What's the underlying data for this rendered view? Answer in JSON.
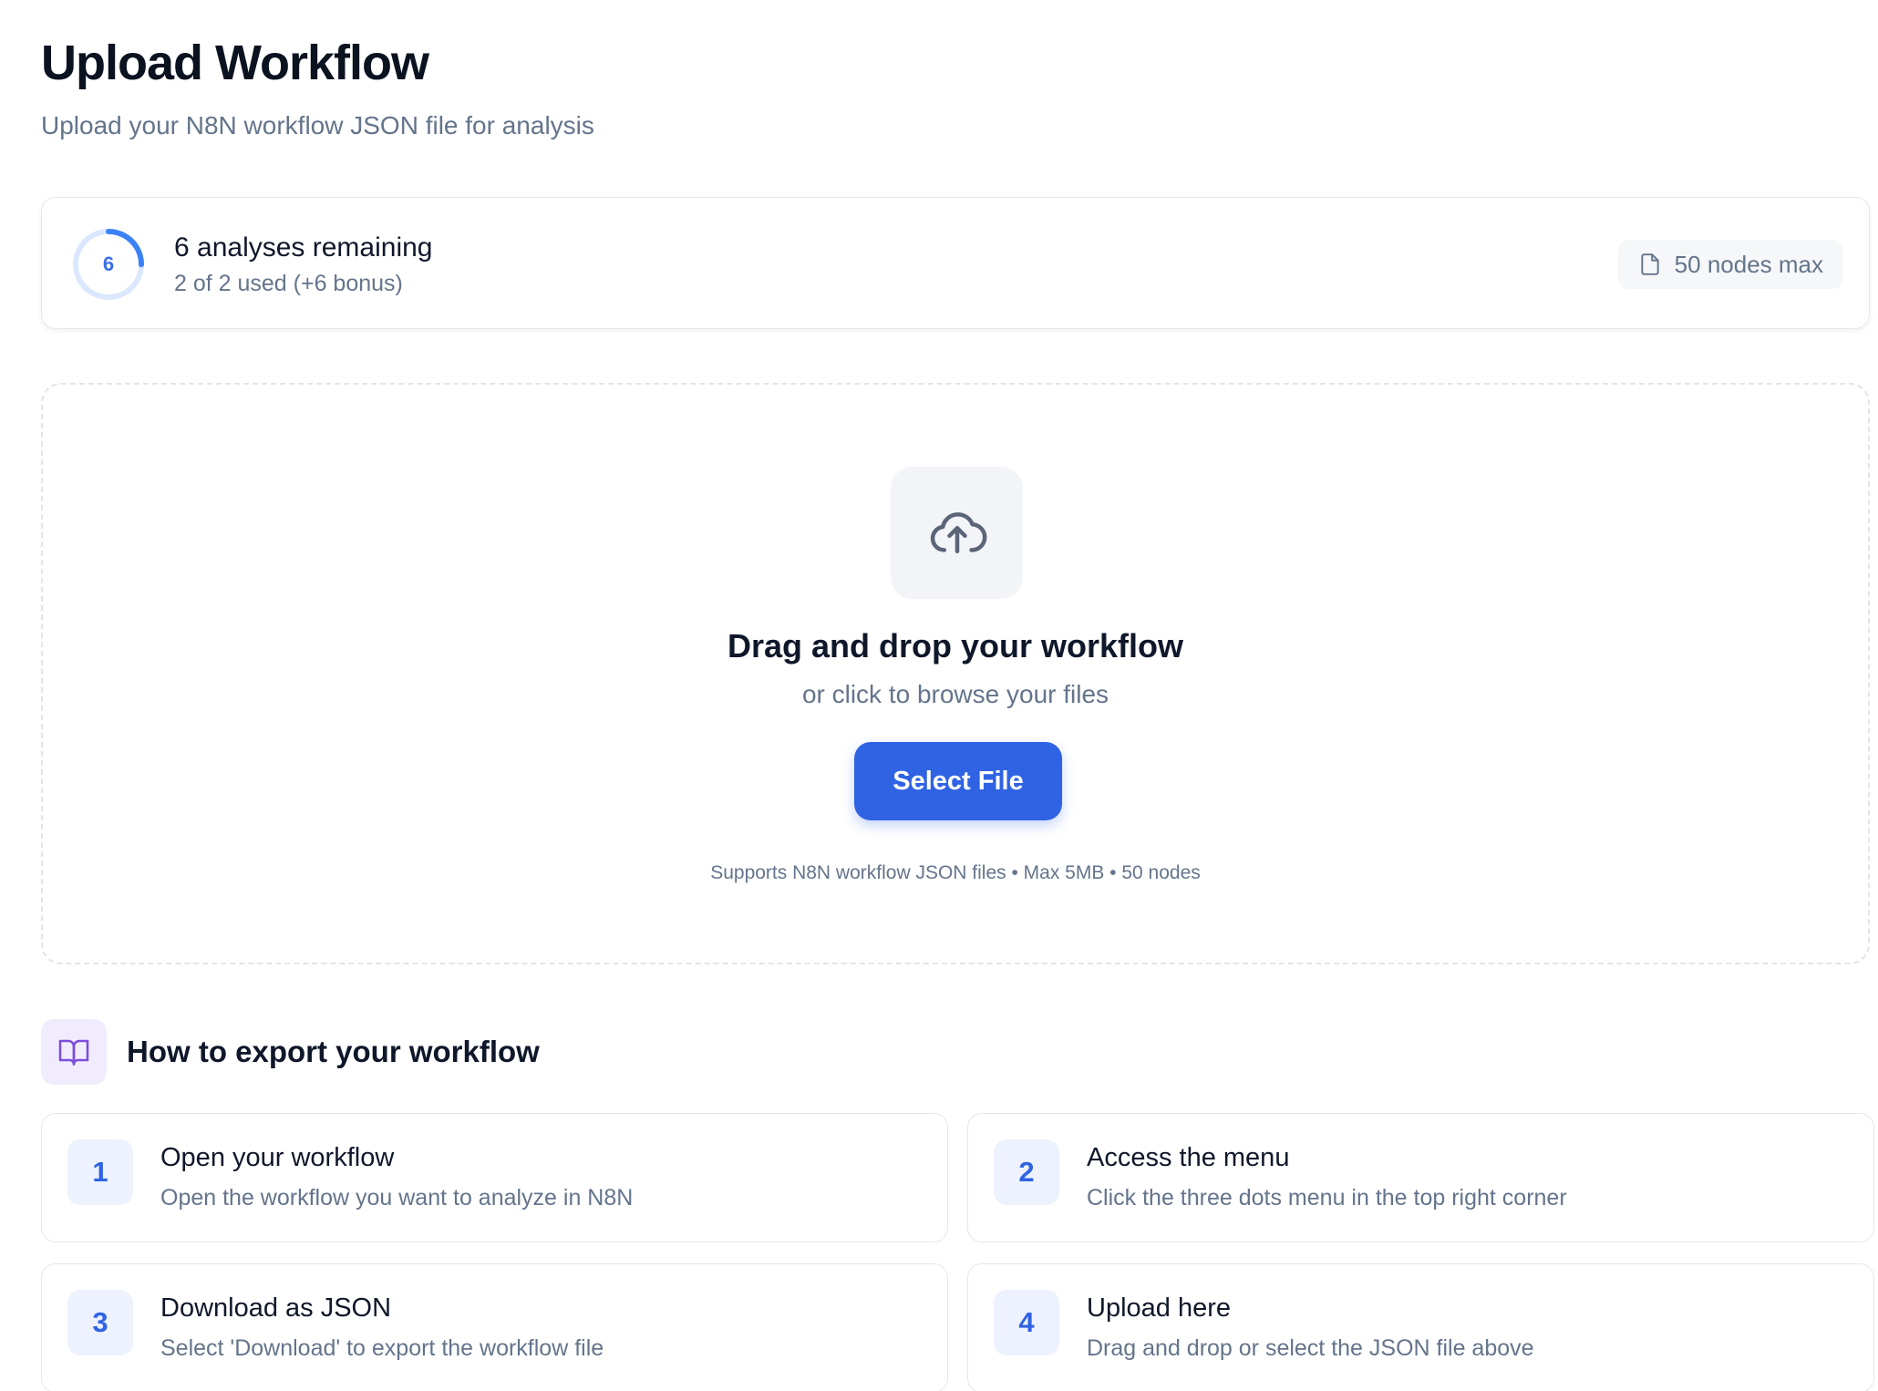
{
  "header": {
    "title": "Upload Workflow",
    "subtitle": "Upload your N8N workflow JSON file for analysis"
  },
  "quota": {
    "remaining_number": "6",
    "remaining_label": "6 analyses remaining",
    "usage_label": "2 of 2 used (+6 bonus)",
    "ring_fill_fraction": 0.25,
    "nodes_badge": "50 nodes max"
  },
  "dropzone": {
    "title": "Drag and drop your workflow",
    "subtitle": "or click to browse your files",
    "button_label": "Select File",
    "hint": "Supports N8N workflow JSON files • Max 5MB • 50 nodes"
  },
  "howto": {
    "title": "How to export your workflow",
    "steps": [
      {
        "number": "1",
        "title": "Open your workflow",
        "description": "Open the workflow you want to analyze in N8N"
      },
      {
        "number": "2",
        "title": "Access the menu",
        "description": "Click the three dots menu in the top right corner"
      },
      {
        "number": "3",
        "title": "Download as JSON",
        "description": "Select 'Download' to export the workflow file"
      },
      {
        "number": "4",
        "title": "Upload here",
        "description": "Drag and drop or select the JSON file above"
      }
    ]
  },
  "colors": {
    "accent": "#2f63e3",
    "ring_track": "#dbe7fd",
    "ring_fill": "#3b82f6",
    "muted_text": "#64748b"
  }
}
